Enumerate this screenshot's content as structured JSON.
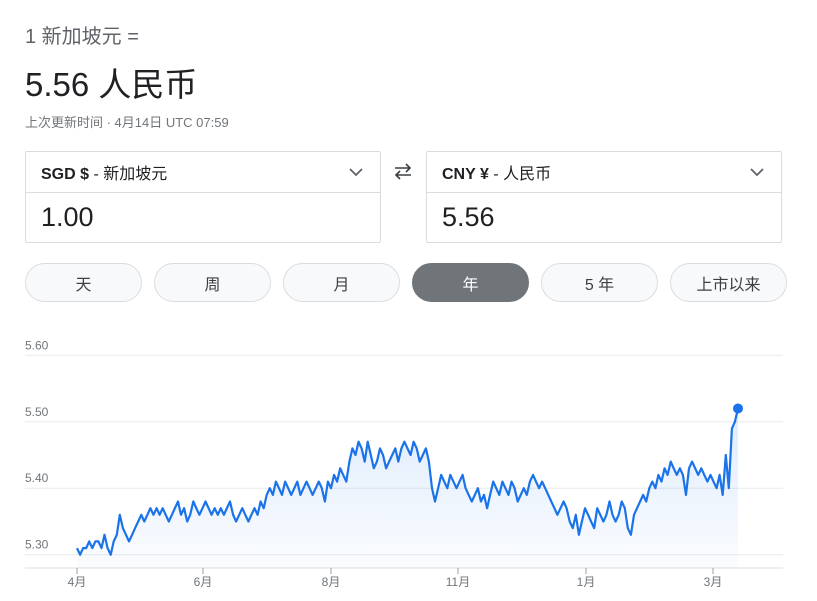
{
  "header": {
    "from_text": "1 新加坡元 =",
    "result_text": "5.56 人民币",
    "updated_text": "上次更新时间 · 4月14日 UTC 07:59"
  },
  "converter": {
    "from": {
      "code": "SGD $",
      "separator": " - ",
      "name": "新加坡元",
      "value": "1.00"
    },
    "to": {
      "code": "CNY ¥",
      "separator": " - ",
      "name": "人民币",
      "value": "5.56"
    }
  },
  "icons": {
    "swap": "swap-arrows-icon",
    "dropdown": "chevron-down-icon"
  },
  "range_tabs": [
    {
      "label": "天"
    },
    {
      "label": "周"
    },
    {
      "label": "月"
    },
    {
      "label": "年",
      "active": true
    },
    {
      "label": "5 年"
    },
    {
      "label": "上市以来"
    }
  ],
  "colors": {
    "line": "#1a73e8",
    "active_tab": "#70757a",
    "grid": "#e8eaed"
  },
  "chart_data": {
    "type": "line",
    "title": "",
    "xlabel": "",
    "ylabel": "",
    "ylim": [
      5.28,
      5.62
    ],
    "y_ticks": [
      "5.30",
      "5.40",
      "5.50",
      "5.60"
    ],
    "x_ticks": [
      "4月",
      "6月",
      "8月",
      "11月",
      "1月",
      "3月"
    ],
    "grid": true,
    "series": [
      {
        "values": [
          5.31,
          5.3,
          5.31,
          5.31,
          5.32,
          5.31,
          5.32,
          5.32,
          5.31,
          5.33,
          5.31,
          5.3,
          5.32,
          5.33,
          5.36,
          5.34,
          5.33,
          5.32,
          5.33,
          5.34,
          5.35,
          5.36,
          5.35,
          5.36,
          5.37,
          5.36,
          5.37,
          5.36,
          5.37,
          5.36,
          5.35,
          5.36,
          5.37,
          5.38,
          5.36,
          5.37,
          5.35,
          5.36,
          5.38,
          5.37,
          5.36,
          5.37,
          5.38,
          5.37,
          5.36,
          5.37,
          5.36,
          5.37,
          5.36,
          5.37,
          5.38,
          5.36,
          5.35,
          5.36,
          5.37,
          5.36,
          5.35,
          5.36,
          5.37,
          5.36,
          5.38,
          5.37,
          5.39,
          5.4,
          5.39,
          5.41,
          5.4,
          5.39,
          5.41,
          5.4,
          5.39,
          5.4,
          5.41,
          5.39,
          5.4,
          5.41,
          5.4,
          5.39,
          5.4,
          5.41,
          5.4,
          5.38,
          5.41,
          5.4,
          5.42,
          5.41,
          5.43,
          5.42,
          5.41,
          5.44,
          5.46,
          5.45,
          5.47,
          5.46,
          5.44,
          5.47,
          5.45,
          5.43,
          5.44,
          5.46,
          5.45,
          5.43,
          5.44,
          5.45,
          5.46,
          5.44,
          5.46,
          5.47,
          5.46,
          5.45,
          5.47,
          5.46,
          5.44,
          5.45,
          5.46,
          5.44,
          5.4,
          5.38,
          5.4,
          5.42,
          5.41,
          5.4,
          5.42,
          5.41,
          5.4,
          5.41,
          5.42,
          5.4,
          5.39,
          5.38,
          5.39,
          5.4,
          5.38,
          5.39,
          5.37,
          5.39,
          5.41,
          5.4,
          5.39,
          5.41,
          5.4,
          5.39,
          5.41,
          5.4,
          5.38,
          5.39,
          5.4,
          5.39,
          5.41,
          5.42,
          5.41,
          5.4,
          5.41,
          5.4,
          5.39,
          5.38,
          5.37,
          5.36,
          5.37,
          5.38,
          5.37,
          5.35,
          5.34,
          5.36,
          5.33,
          5.35,
          5.37,
          5.36,
          5.35,
          5.34,
          5.37,
          5.36,
          5.35,
          5.36,
          5.38,
          5.36,
          5.35,
          5.36,
          5.38,
          5.37,
          5.34,
          5.33,
          5.36,
          5.37,
          5.38,
          5.39,
          5.38,
          5.4,
          5.41,
          5.4,
          5.42,
          5.41,
          5.43,
          5.42,
          5.44,
          5.43,
          5.42,
          5.43,
          5.42,
          5.39,
          5.43,
          5.44,
          5.43,
          5.42,
          5.43,
          5.42,
          5.41,
          5.42,
          5.41,
          5.4,
          5.42,
          5.39,
          5.45,
          5.4,
          5.49,
          5.5,
          5.52
        ]
      }
    ],
    "last_point": 5.52
  }
}
